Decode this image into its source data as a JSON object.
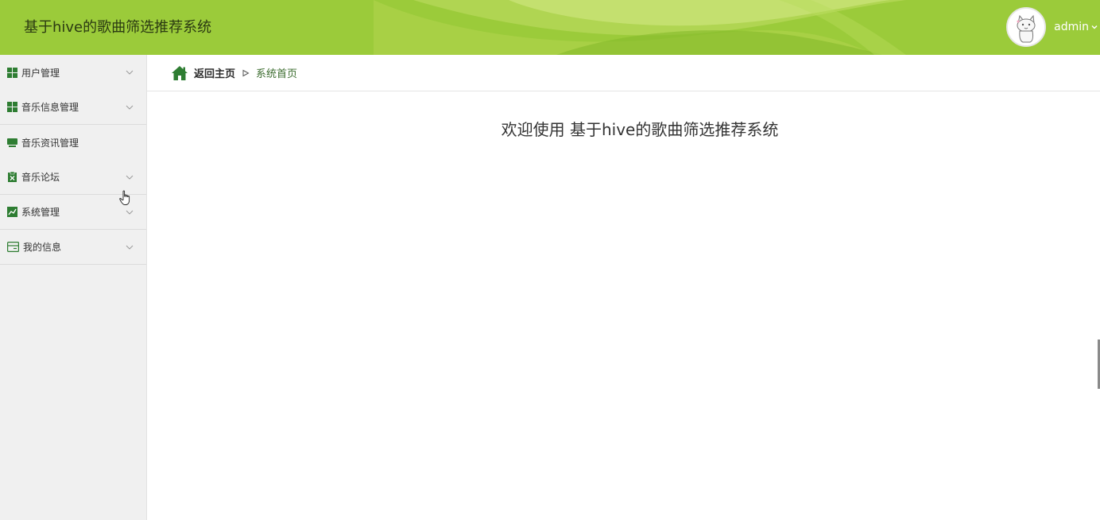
{
  "header": {
    "app_title": "基于hive的歌曲筛选推荐系统",
    "username": "admin",
    "background_color": "#9bcb3a",
    "avatar_icon": "cat-avatar-icon"
  },
  "sidebar": {
    "items": [
      {
        "label": "用户管理",
        "icon": "grid-icon",
        "has_chevron": true
      },
      {
        "label": "音乐信息管理",
        "icon": "grid-icon",
        "has_chevron": true
      },
      {
        "label": "音乐资讯管理",
        "icon": "monitor-icon",
        "has_chevron": false
      },
      {
        "label": "音乐论坛",
        "icon": "clipboard-x-icon",
        "has_chevron": true
      },
      {
        "label": "系统管理",
        "icon": "chart-icon",
        "has_chevron": true
      },
      {
        "label": "我的信息",
        "icon": "card-icon",
        "has_chevron": true
      }
    ]
  },
  "breadcrumb": {
    "home_label": "返回主页",
    "current": "系统首页"
  },
  "main": {
    "welcome_text": "欢迎使用 基于hive的歌曲筛选推荐系统"
  },
  "colors": {
    "accent_green": "#2e7d32",
    "header_green": "#9bcb3a",
    "sidebar_bg": "#f0f0f0"
  }
}
